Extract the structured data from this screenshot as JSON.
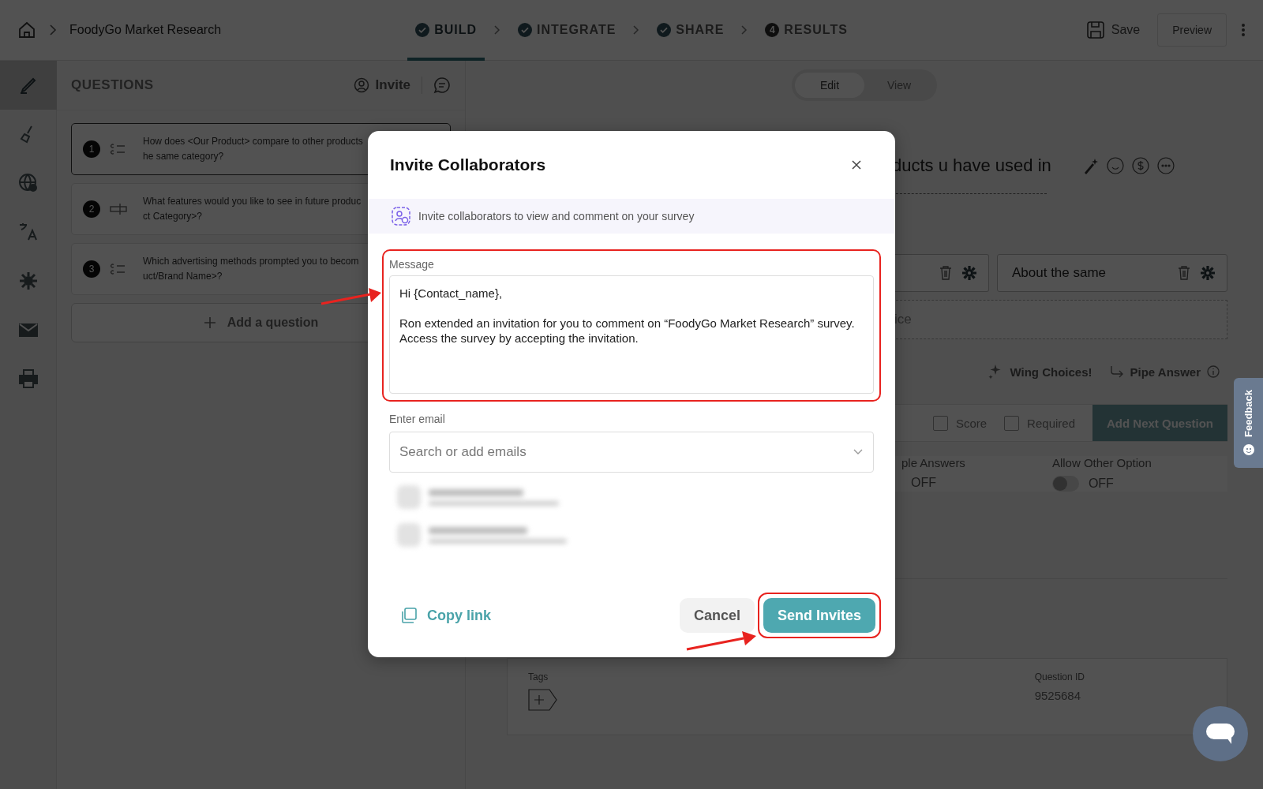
{
  "top_bar": {
    "title": "FoodyGo Market Research",
    "steps": [
      {
        "label": "BUILD",
        "kind": "done",
        "selected": true
      },
      {
        "label": "INTEGRATE",
        "kind": "done",
        "selected": false
      },
      {
        "label": "SHARE",
        "kind": "done",
        "selected": false
      },
      {
        "label": "RESULTS",
        "kind": "number",
        "number": "4",
        "selected": false
      }
    ],
    "save": "Save",
    "preview": "Preview"
  },
  "rail": [
    {
      "kind": "pen",
      "selected": true
    },
    {
      "kind": "brush",
      "selected": false
    },
    {
      "kind": "globe",
      "selected": false
    },
    {
      "kind": "translate",
      "selected": false
    },
    {
      "kind": "gear",
      "selected": false
    },
    {
      "kind": "mail",
      "selected": false
    },
    {
      "kind": "print",
      "selected": false
    }
  ],
  "questions_panel": {
    "title": "QUESTIONS",
    "invite": "Invite",
    "questions": [
      {
        "number": "1",
        "kind": "choice",
        "lines": [
          "How does <Our Product> compare to other products",
          "he same category?"
        ]
      },
      {
        "number": "2",
        "kind": "text",
        "lines": [
          "What features would you like to see in future produc",
          "ct Category>?"
        ]
      },
      {
        "number": "3",
        "kind": "choice",
        "lines": [
          "Which advertising methods prompted you to becom",
          "uct/Brand Name>?"
        ]
      }
    ],
    "add_question": "Add a question"
  },
  "view_toggle": [
    {
      "label": "Edit",
      "selected": true
    },
    {
      "label": "View",
      "selected": false
    }
  ],
  "editor": {
    "question_text": "ducts u have used in",
    "choices": [
      {
        "label": "About the same"
      }
    ],
    "add_choice": "ice",
    "wing_choices": "Wing Choices!",
    "pipe_answer": "Pipe Answer",
    "options": [
      {
        "label": "Score",
        "checked": false
      },
      {
        "label": "Required",
        "checked": false
      }
    ],
    "add_next": "Add Next Question",
    "toggles": [
      {
        "label": "ple Answers",
        "state": "OFF"
      },
      {
        "label": "Allow Other Option",
        "state": "OFF",
        "on": false
      }
    ],
    "tags_label": "Tags",
    "question_id_label": "Question ID",
    "question_id": "9525684"
  },
  "feedback": "Feedback",
  "modal": {
    "title": "Invite Collaborators",
    "banner": "Invite collaborators to view and comment on your survey",
    "message_label": "Message",
    "message": "Hi {Contact_name},\n\nRon extended an invitation for you to comment on “FoodyGo Market Research” survey. Access the survey by accepting the invitation.",
    "email_label": "Enter email",
    "email_placeholder": "Search or add emails",
    "copy_link": "Copy link",
    "cancel": "Cancel",
    "send": "Send Invites"
  }
}
